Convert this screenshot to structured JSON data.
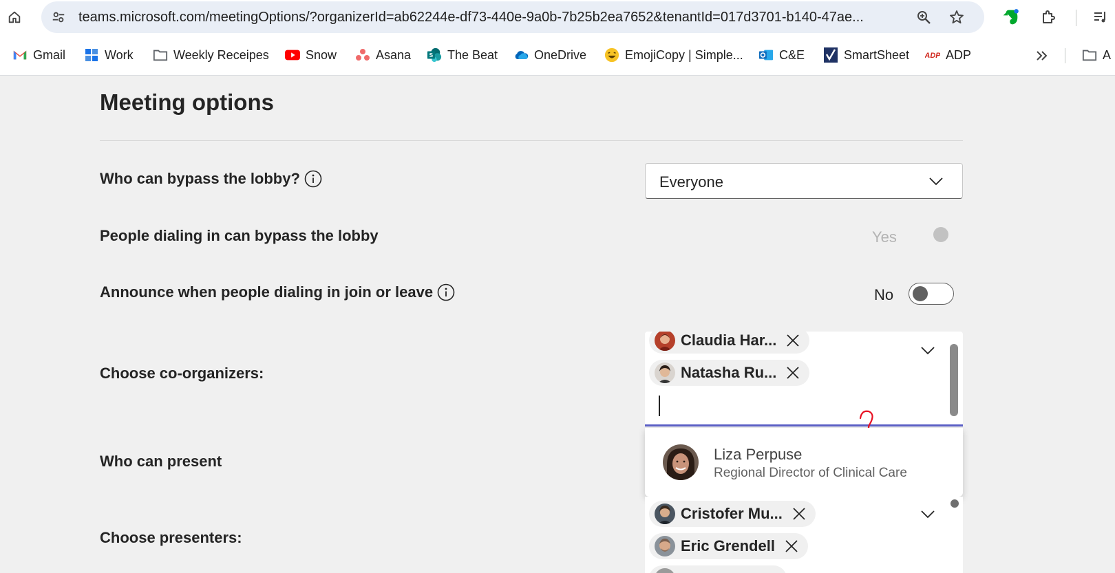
{
  "browser": {
    "url": "teams.microsoft.com/meetingOptions/?organizerId=ab62244e-df73-440e-9a0b-7b25b2ea7652&tenantId=017d3701-b140-47ae...",
    "bookmarks": [
      {
        "label": "Gmail",
        "icon": "gmail-icon",
        "color": "#ea4335"
      },
      {
        "label": "Work",
        "icon": "grid-icon",
        "color": "#1a73e8"
      },
      {
        "label": "Weekly Receipes",
        "icon": "folder-icon",
        "color": "#5f6368"
      },
      {
        "label": "Snow",
        "icon": "youtube-icon",
        "color": "#ff0000"
      },
      {
        "label": "Asana",
        "icon": "asana-icon",
        "color": "#f06a6a"
      },
      {
        "label": "The Beat",
        "icon": "sharepoint-icon",
        "color": "#038387"
      },
      {
        "label": "OneDrive",
        "icon": "cloud-icon",
        "color": "#0364b8"
      },
      {
        "label": "EmojiCopy | Simple...",
        "icon": "emoji-icon",
        "color": "#f7b500"
      },
      {
        "label": "C&E",
        "icon": "outlook-icon",
        "color": "#0f6cbd"
      },
      {
        "label": "SmartSheet",
        "icon": "smartsheet-icon",
        "color": "#1f3264"
      },
      {
        "label": "ADP",
        "icon": "adp-icon",
        "color": "#d0271d"
      }
    ],
    "bookmarks_overflow_label": "A"
  },
  "page": {
    "title": "Meeting options",
    "bypass_lobby": {
      "label": "Who can bypass the lobby?",
      "value": "Everyone"
    },
    "dial_in_bypass": {
      "label": "People dialing in can bypass the lobby",
      "state": "Yes"
    },
    "announce": {
      "label": "Announce when people dialing in join or leave",
      "state": "No"
    },
    "co_organizers": {
      "label": "Choose co-organizers:",
      "chips": [
        "Claudia Har...",
        "Natasha Ru..."
      ],
      "input_value": ""
    },
    "suggestion": {
      "name": "Liza Perpuse",
      "title": "Regional Director of Clinical Care"
    },
    "who_can_present": {
      "label": "Who can present"
    },
    "presenters": {
      "label": "Choose presenters:",
      "chips": [
        "Cristofer Mu...",
        "Eric Grendell"
      ]
    }
  },
  "colors": {
    "accent": "#5b5fc7",
    "annotation": "#e81123"
  }
}
